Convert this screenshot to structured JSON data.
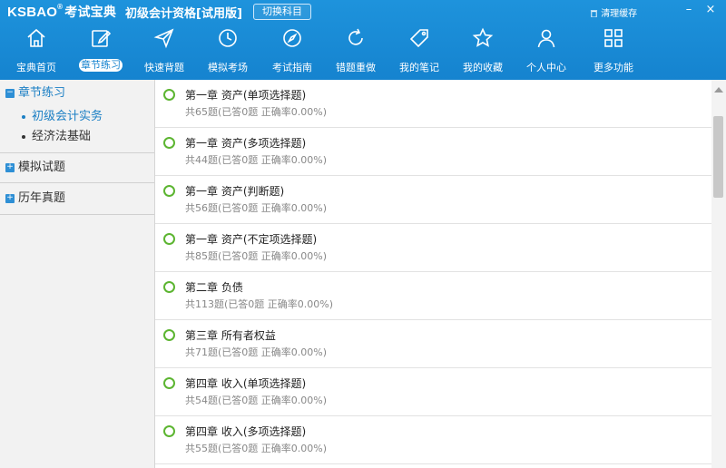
{
  "app": {
    "logo_text": "KSBAO",
    "logo_reg": "®",
    "logo_cn": "考试宝典",
    "subject_title": "初级会计资格[试用版]",
    "switch_label": "切换科目",
    "clear_cache_label": "清理缓存"
  },
  "window_controls": {
    "minimize": "–",
    "close": "×"
  },
  "nav": [
    {
      "label": "宝典首页",
      "icon": "home-icon",
      "active": false
    },
    {
      "label": "章节练习",
      "icon": "edit-icon",
      "active": true
    },
    {
      "label": "快速背题",
      "icon": "send-icon",
      "active": false
    },
    {
      "label": "模拟考场",
      "icon": "clock-icon",
      "active": false
    },
    {
      "label": "考试指南",
      "icon": "compass-icon",
      "active": false
    },
    {
      "label": "错题重做",
      "icon": "refresh-icon",
      "active": false
    },
    {
      "label": "我的笔记",
      "icon": "tag-icon",
      "active": false
    },
    {
      "label": "我的收藏",
      "icon": "star-icon",
      "active": false
    },
    {
      "label": "个人中心",
      "icon": "user-icon",
      "active": false
    },
    {
      "label": "更多功能",
      "icon": "grid-icon",
      "active": false
    }
  ],
  "sidebar": {
    "groups": [
      {
        "label": "章节练习",
        "toggle": "−",
        "open": true,
        "items": [
          {
            "label": "初级会计实务",
            "active": true
          },
          {
            "label": "经济法基础",
            "active": false
          }
        ]
      },
      {
        "label": "模拟试题",
        "toggle": "+",
        "open": false,
        "items": []
      },
      {
        "label": "历年真题",
        "toggle": "+",
        "open": false,
        "items": []
      }
    ]
  },
  "chapters": [
    {
      "title": "第一章 资产(单项选择题)",
      "stats": "共65题(已答0题   正确率0.00%)"
    },
    {
      "title": "第一章 资产(多项选择题)",
      "stats": "共44题(已答0题   正确率0.00%)"
    },
    {
      "title": "第一章 资产(判断题)",
      "stats": "共56题(已答0题   正确率0.00%)"
    },
    {
      "title": "第一章 资产(不定项选择题)",
      "stats": "共85题(已答0题   正确率0.00%)"
    },
    {
      "title": "第二章 负债",
      "stats": "共113题(已答0题   正确率0.00%)"
    },
    {
      "title": "第三章 所有者权益",
      "stats": "共71题(已答0题   正确率0.00%)"
    },
    {
      "title": "第四章 收入(单项选择题)",
      "stats": "共54题(已答0题   正确率0.00%)"
    },
    {
      "title": "第四章 收入(多项选择题)",
      "stats": "共55题(已答0题   正确率0.00%)"
    }
  ],
  "colors": {
    "header": "#1583cf",
    "accent": "#1b7fc4",
    "status_circle": "#5cb531"
  }
}
